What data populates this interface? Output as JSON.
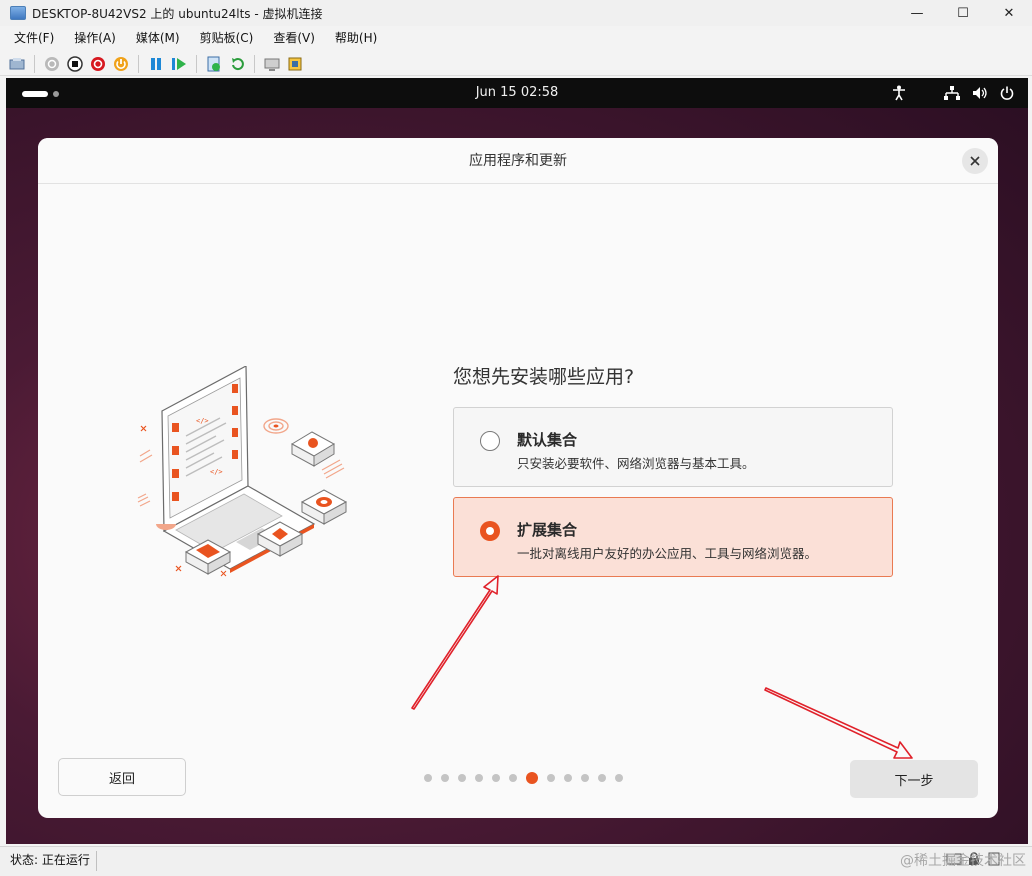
{
  "window": {
    "title": "DESKTOP-8U42VS2 上的 ubuntu24lts - 虚拟机连接",
    "controls": {
      "minimize": "—",
      "maximize": "☐",
      "close": "✕"
    }
  },
  "menu": [
    {
      "label": "文件(F)"
    },
    {
      "label": "操作(A)"
    },
    {
      "label": "媒体(M)"
    },
    {
      "label": "剪贴板(C)"
    },
    {
      "label": "查看(V)"
    },
    {
      "label": "帮助(H)"
    }
  ],
  "toolbar": {
    "icons": [
      "ctrl-alt-del-icon",
      "start-icon",
      "turn-off-icon",
      "shut-down-icon",
      "save-icon",
      "pause-icon",
      "resume-icon",
      "checkpoint-icon",
      "revert-icon",
      "enhanced-session-icon",
      "share-icon"
    ]
  },
  "topbar": {
    "clock": "Jun 15  02:58"
  },
  "dialog": {
    "title": "应用程序和更新",
    "question": "您想先安装哪些应用?",
    "options": [
      {
        "title": "默认集合",
        "description": "只安装必要软件、网络浏览器与基本工具。",
        "selected": false
      },
      {
        "title": "扩展集合",
        "description": "一批对离线用户友好的办公应用、工具与网络浏览器。",
        "selected": true
      }
    ],
    "back_label": "返回",
    "next_label": "下一步",
    "pager": {
      "total": 12,
      "current": 7
    }
  },
  "colors": {
    "accent": "#e95420",
    "selected_bg": "#fbe0d7",
    "annotation": "#e0212a"
  },
  "status": {
    "text": "状态: 正在运行",
    "watermark": "@稀土掘金技术社区"
  }
}
